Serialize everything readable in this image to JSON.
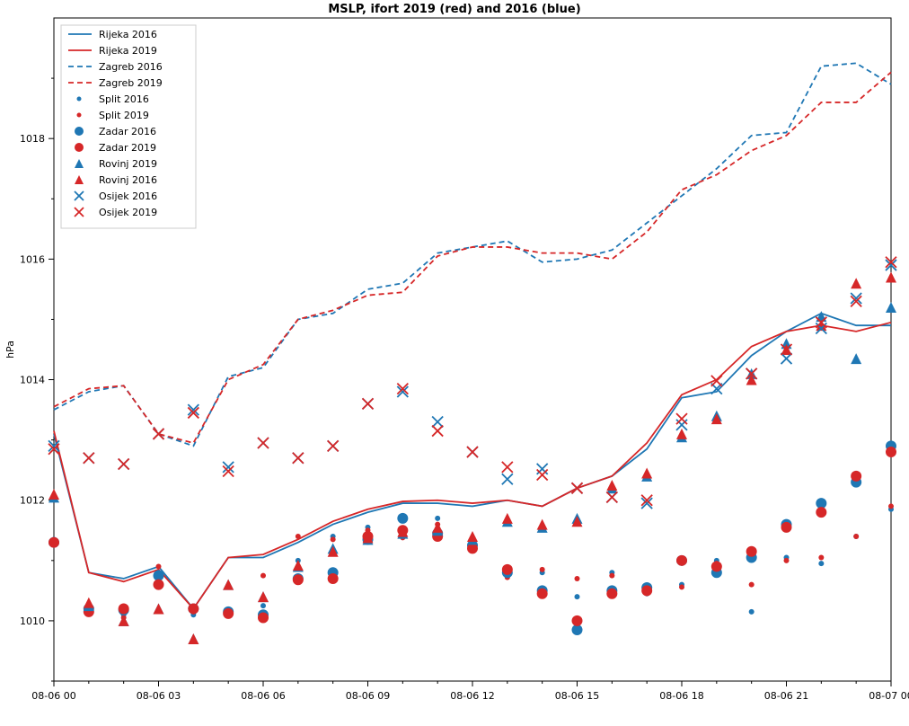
{
  "chart_data": {
    "type": "line",
    "title": "MSLP, ifort 2019 (red) and 2016 (blue)",
    "ylabel": "hPa",
    "xlabel": "",
    "ylim": [
      1009,
      1020
    ],
    "x_tick_labels": [
      "08-06 00",
      "08-06 03",
      "08-06 06",
      "08-06 09",
      "08-06 12",
      "08-06 15",
      "08-06 18",
      "08-06 21",
      "08-07 00"
    ],
    "x_tick_positions": [
      0,
      3,
      6,
      9,
      12,
      15,
      18,
      21,
      24
    ],
    "x_range": [
      0,
      24
    ],
    "categories_hours": [
      0,
      1,
      2,
      3,
      4,
      5,
      6,
      7,
      8,
      9,
      10,
      11,
      12,
      13,
      14,
      15,
      16,
      17,
      18,
      19,
      20,
      21,
      22,
      23,
      24
    ],
    "series": [
      {
        "name": "Rijeka 2016",
        "color": "#1f77b4",
        "style": "line",
        "dash": null,
        "marker": null,
        "values": [
          1013.1,
          1010.8,
          1010.7,
          1010.9,
          1010.2,
          1011.05,
          1011.05,
          1011.3,
          1011.6,
          1011.8,
          1011.95,
          1011.95,
          1011.9,
          1012.0,
          1011.9,
          1012.2,
          1012.4,
          1012.85,
          1013.7,
          1013.8,
          1014.4,
          1014.8,
          1015.1,
          1014.9,
          1014.9
        ]
      },
      {
        "name": "Rijeka 2019",
        "color": "#d62728",
        "style": "line",
        "dash": null,
        "marker": null,
        "values": [
          1013.15,
          1010.8,
          1010.65,
          1010.85,
          1010.2,
          1011.05,
          1011.1,
          1011.35,
          1011.65,
          1011.85,
          1011.98,
          1012.0,
          1011.95,
          1012.0,
          1011.9,
          1012.2,
          1012.4,
          1012.95,
          1013.75,
          1014.0,
          1014.55,
          1014.8,
          1014.9,
          1014.8,
          1014.95
        ]
      },
      {
        "name": "Zagreb 2016",
        "color": "#1f77b4",
        "style": "line",
        "dash": "6,4",
        "marker": null,
        "values": [
          1013.5,
          1013.8,
          1013.9,
          1013.1,
          1012.9,
          1014.05,
          1014.2,
          1015.0,
          1015.1,
          1015.5,
          1015.6,
          1016.1,
          1016.2,
          1016.3,
          1015.95,
          1016.0,
          1016.15,
          1016.6,
          1017.05,
          1017.5,
          1018.05,
          1018.1,
          1019.2,
          1019.25,
          1018.9
        ]
      },
      {
        "name": "Zagreb 2019",
        "color": "#d62728",
        "style": "line",
        "dash": "6,4",
        "marker": null,
        "values": [
          1013.55,
          1013.85,
          1013.9,
          1013.1,
          1012.95,
          1014.0,
          1014.25,
          1015.0,
          1015.15,
          1015.4,
          1015.45,
          1016.05,
          1016.2,
          1016.2,
          1016.1,
          1016.1,
          1016.0,
          1016.45,
          1017.15,
          1017.4,
          1017.8,
          1018.05,
          1018.6,
          1018.6,
          1019.1
        ]
      },
      {
        "name": "Split 2016",
        "color": "#1f77b4",
        "style": "marker",
        "marker": "dot",
        "size": 3,
        "values": [
          1011.35,
          1010.25,
          1010.1,
          1010.8,
          1010.1,
          1010.1,
          1010.25,
          1011.0,
          1011.4,
          1011.55,
          1011.4,
          1011.7,
          1011.3,
          1010.8,
          1010.8,
          1010.4,
          1010.8,
          1010.45,
          1010.6,
          1011.0,
          1010.15,
          1011.05,
          1010.95,
          1011.4,
          1011.85
        ]
      },
      {
        "name": "Split 2019",
        "color": "#d62728",
        "style": "marker",
        "marker": "dot",
        "size": 3,
        "values": [
          1011.3,
          1010.2,
          1010.05,
          1010.9,
          1010.15,
          1010.15,
          1010.75,
          1011.4,
          1011.35,
          1011.5,
          1011.38,
          1011.6,
          1011.27,
          1010.72,
          1010.85,
          1010.7,
          1010.75,
          1010.5,
          1010.56,
          1010.95,
          1010.6,
          1011.0,
          1011.05,
          1011.4,
          1011.9
        ]
      },
      {
        "name": "Zadar 2016",
        "color": "#1f77b4",
        "style": "marker",
        "marker": "dot",
        "size": 6,
        "values": [
          1011.3,
          1010.2,
          1010.18,
          1010.75,
          1010.2,
          1010.15,
          1010.1,
          1010.7,
          1010.8,
          1011.35,
          1011.7,
          1011.45,
          1011.25,
          1010.8,
          1010.5,
          1009.85,
          1010.5,
          1010.55,
          1011.0,
          1010.8,
          1011.05,
          1011.6,
          1011.95,
          1012.3,
          1012.9
        ]
      },
      {
        "name": "Zadar 2019",
        "color": "#d62728",
        "style": "marker",
        "marker": "dot",
        "size": 6,
        "values": [
          1011.3,
          1010.15,
          1010.2,
          1010.6,
          1010.2,
          1010.12,
          1010.05,
          1010.68,
          1010.7,
          1011.4,
          1011.5,
          1011.4,
          1011.2,
          1010.85,
          1010.45,
          1010.0,
          1010.45,
          1010.5,
          1011.0,
          1010.9,
          1011.15,
          1011.55,
          1011.8,
          1012.4,
          1012.8
        ]
      },
      {
        "name": "Rovinj 2019",
        "color": "#1f77b4",
        "style": "marker",
        "marker": "triangle",
        "size": 6,
        "values": [
          1012.05,
          1010.25,
          1010.0,
          1010.2,
          1009.7,
          1010.6,
          1010.4,
          1010.9,
          1011.2,
          1011.35,
          1011.45,
          1011.5,
          1011.35,
          1011.65,
          1011.55,
          1011.7,
          1012.2,
          1012.4,
          1013.05,
          1013.4,
          1014.1,
          1014.6,
          1015.05,
          1014.35,
          1015.2
        ]
      },
      {
        "name": "Rovinj 2016",
        "color": "#d62728",
        "style": "marker",
        "marker": "triangle",
        "size": 6,
        "values": [
          1012.1,
          1010.3,
          1010.0,
          1010.2,
          1009.7,
          1010.6,
          1010.4,
          1010.92,
          1011.15,
          1011.38,
          1011.48,
          1011.55,
          1011.4,
          1011.7,
          1011.6,
          1011.65,
          1012.25,
          1012.45,
          1013.1,
          1013.35,
          1014.0,
          1014.5,
          1014.9,
          1015.6,
          1015.7
        ]
      },
      {
        "name": "Osijek 2016",
        "color": "#1f77b4",
        "style": "marker",
        "marker": "x",
        "size": 6,
        "values": [
          1012.9,
          1012.7,
          1012.6,
          1013.1,
          1013.5,
          1012.55,
          1012.95,
          1012.7,
          1012.9,
          1013.6,
          1013.8,
          1013.3,
          1012.8,
          1012.35,
          1012.52,
          1012.2,
          1012.05,
          1011.95,
          1013.25,
          1013.85,
          1014.1,
          1014.35,
          1014.85,
          1015.35,
          1015.9
        ]
      },
      {
        "name": "Osijek 2019",
        "color": "#d62728",
        "style": "marker",
        "marker": "x",
        "size": 6,
        "values": [
          1012.85,
          1012.7,
          1012.6,
          1013.1,
          1013.45,
          1012.48,
          1012.95,
          1012.7,
          1012.9,
          1013.6,
          1013.85,
          1013.15,
          1012.8,
          1012.55,
          1012.42,
          1012.2,
          1012.05,
          1012.0,
          1013.35,
          1013.98,
          1014.1,
          1014.5,
          1014.95,
          1015.3,
          1015.95
        ]
      }
    ],
    "legend": {
      "position": "upper left",
      "items": [
        {
          "label": "Rijeka 2016",
          "color": "#1f77b4",
          "kind": "line"
        },
        {
          "label": "Rijeka 2019",
          "color": "#d62728",
          "kind": "line"
        },
        {
          "label": "Zagreb 2016",
          "color": "#1f77b4",
          "kind": "dash"
        },
        {
          "label": "Zagreb 2019",
          "color": "#d62728",
          "kind": "dash"
        },
        {
          "label": "Split 2016",
          "color": "#1f77b4",
          "kind": "dot-sm"
        },
        {
          "label": "Split 2019",
          "color": "#d62728",
          "kind": "dot-sm"
        },
        {
          "label": "Zadar 2016",
          "color": "#1f77b4",
          "kind": "dot"
        },
        {
          "label": "Zadar 2019",
          "color": "#d62728",
          "kind": "dot"
        },
        {
          "label": "Rovinj 2019",
          "color": "#1f77b4",
          "kind": "tri"
        },
        {
          "label": "Rovinj 2016",
          "color": "#d62728",
          "kind": "tri"
        },
        {
          "label": "Osijek 2016",
          "color": "#1f77b4",
          "kind": "x"
        },
        {
          "label": "Osijek 2019",
          "color": "#d62728",
          "kind": "x"
        }
      ]
    }
  }
}
